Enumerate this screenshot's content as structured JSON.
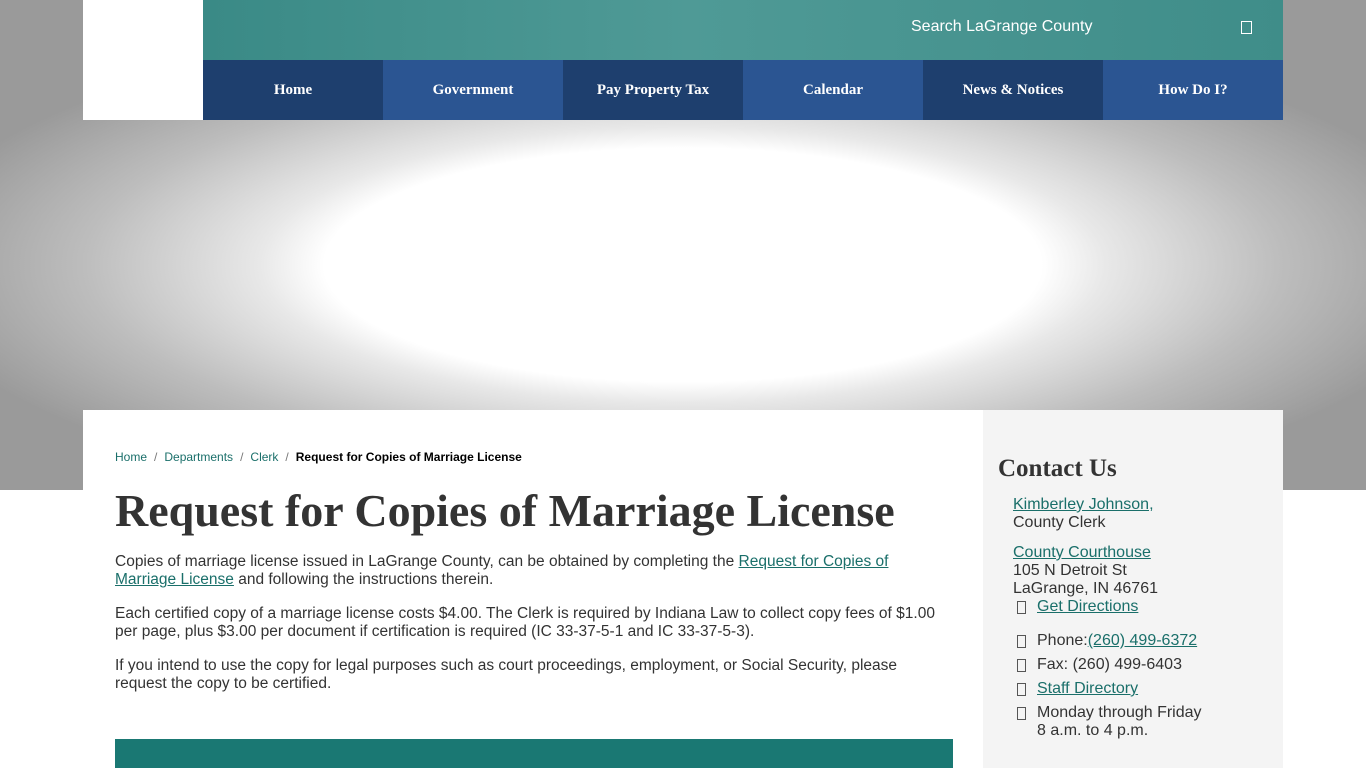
{
  "header": {
    "search_label": "Search LaGrange County",
    "search_icon": "search-icon"
  },
  "nav": {
    "items": [
      {
        "label": "Home"
      },
      {
        "label": "Government"
      },
      {
        "label": "Pay Property Tax"
      },
      {
        "label": "Calendar"
      },
      {
        "label": "News & Notices"
      },
      {
        "label": "How Do I?"
      }
    ]
  },
  "breadcrumb": {
    "items": [
      "Home",
      "Departments",
      "Clerk"
    ],
    "separator": "/",
    "current": "Request for Copies of Marriage License"
  },
  "main": {
    "title": "Request for Copies of Marriage License",
    "p1_before": "Copies of marriage license issued in LaGrange County, can be obtained by completing the ",
    "p1_link": "Request for Copies of Marriage License",
    "p1_after": " and following the instructions therein.",
    "p2": "Each certified copy of a marriage license costs $4.00. The Clerk is required by Indiana Law to collect copy fees of $1.00 per page, plus $3.00 per document if certification is required (IC 33-37-5-1 and IC 33-37-5-3).",
    "p3": "If you intend to use the copy for legal purposes such as court proceedings, employment, or Social Security, please request the copy to be certified.",
    "banner_text": " "
  },
  "sidebar": {
    "title": "Contact Us",
    "contact_name": "Kimberley Johnson,",
    "contact_role": "County Clerk",
    "location_name": "County Courthouse",
    "address_line1": "105 N Detroit St",
    "address_line2": "LaGrange, IN 46761",
    "directions": "Get Directions",
    "phone_label": "Phone: ",
    "phone": "(260) 499-6372",
    "fax": "Fax: (260) 499-6403",
    "staff_directory": "Staff Directory",
    "hours_line1": "Monday through Friday",
    "hours_line2": "8 a.m. to 4 p.m."
  },
  "colors": {
    "topbar": "#3a8a86",
    "nav_dark": "#1e3f6e",
    "nav_light": "#2b5592",
    "link": "#1a6f6a",
    "banner": "#1a7873"
  }
}
